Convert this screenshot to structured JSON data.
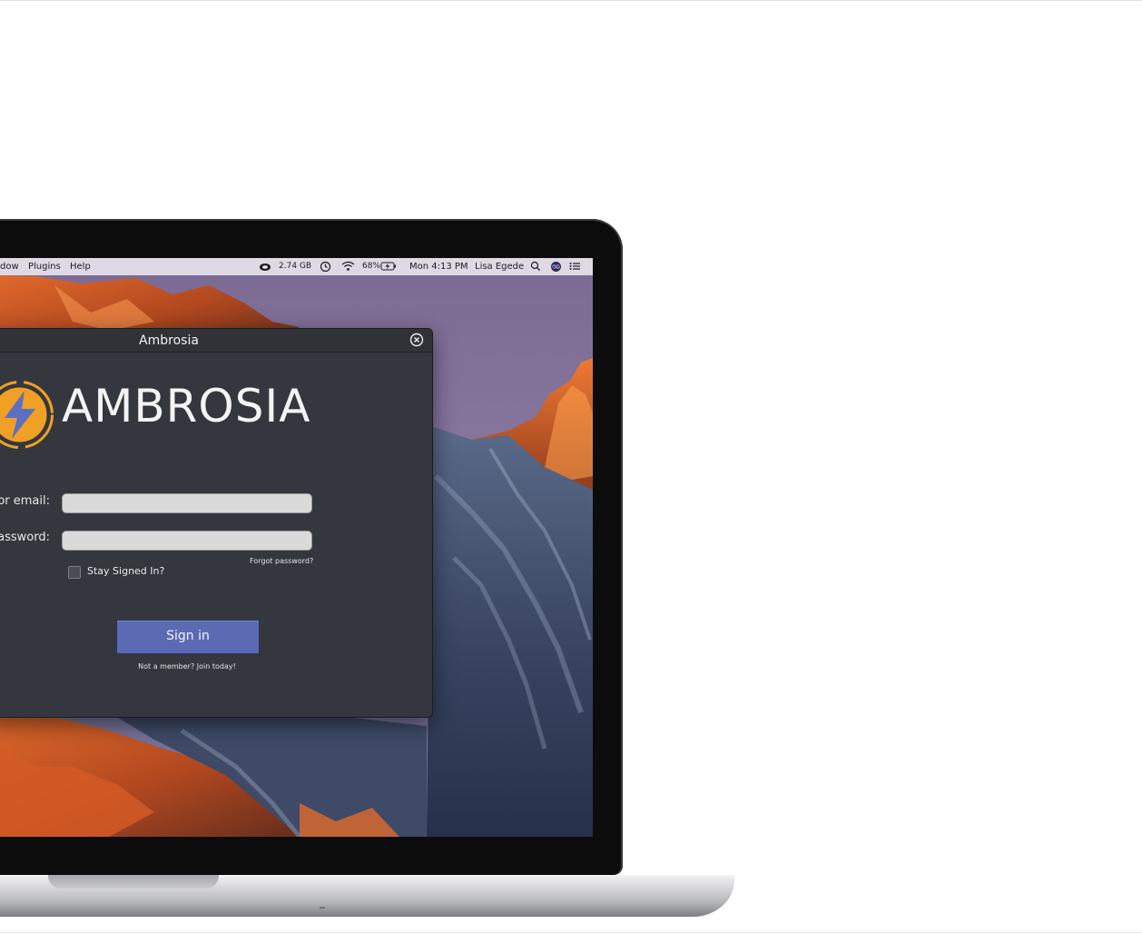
{
  "menubar": {
    "menus": [
      "dow",
      "Plugins",
      "Help"
    ],
    "status": {
      "memory": "2.74 GB",
      "battery": "68%",
      "datetime": "Mon 4:13 PM",
      "user": "Lisa Egede"
    },
    "icons": [
      "creative-cloud-icon",
      "time-machine-icon",
      "wifi-icon",
      "battery-charging-icon",
      "spotlight-search-icon",
      "siri-icon",
      "notification-center-icon"
    ]
  },
  "dialog": {
    "window_title": "Ambrosia",
    "logo_text": "AMBROSIA",
    "username_label": "or email:",
    "password_label": "Password:",
    "username_value": "",
    "password_value": "",
    "forgot_link": "Forgot password?",
    "stay_signed_in": "Stay Signed In?",
    "stay_signed_in_checked": false,
    "signin_label": "Sign in",
    "join_link": "Not a member? Join today!"
  },
  "colors": {
    "dialog_bg": "#34373d",
    "signin_button": "#5b6ab3",
    "logo_orange": "#f0a024",
    "logo_bolt": "#5d6fc0"
  }
}
